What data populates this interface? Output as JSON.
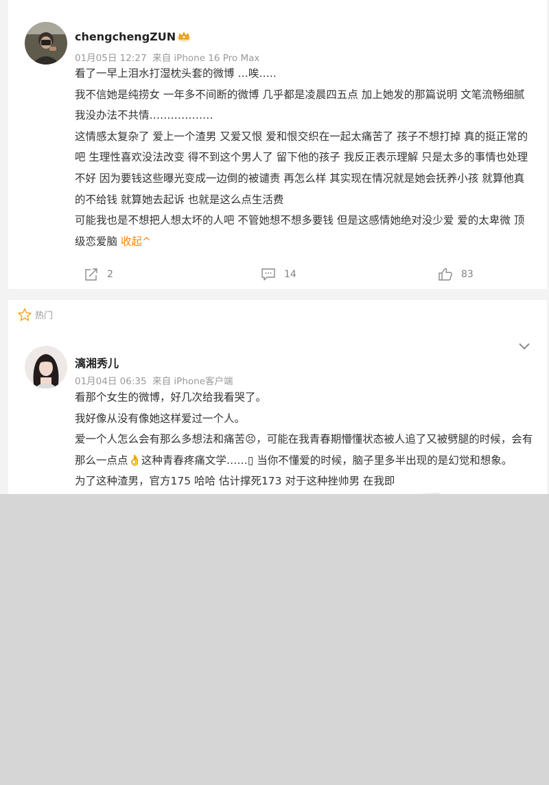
{
  "post": {
    "username": "chengchengZUN",
    "badge_icon": "crown-badge-icon",
    "meta": "01月05日 12:27  来自 iPhone 16 Pro Max",
    "paragraphs": [
      "看了一早上泪水打湿枕头套的微博 …唉…..",
      "我不信她是纯捞女 一年多不间断的微博 几乎都是凌晨四五点 加上她发的那篇说明 文笔流畅细腻 我没办法不共情………………",
      "这情感太复杂了 爱上一个渣男 又爱又恨 爱和恨交织在一起太痛苦了 孩子不想打掉 真的挺正常的吧 生理性喜欢没法改变 得不到这个男人了 留下他的孩子 我反正表示理解 只是太多的事情也处理不好 因为要钱这些曝光变成一边倒的被谴责 再怎么样 其实现在情况就是她会抚养小孩 就算他真的不给钱 就算她去起诉 也就是这么点生活费",
      "可能我也是不想把人想太坏的人吧 不管她想不想多要钱 但是这感情她绝对没少爱 爱的太卑微 顶级恋爱脑"
    ],
    "collapse_label": "收起^",
    "actions": {
      "repost_count": "2",
      "comment_count": "14",
      "like_count": "83"
    }
  },
  "hot_label": "热门",
  "comment": {
    "username": "漓湘秀儿",
    "meta": "01月04日 06:35  来自 iPhone客户端",
    "line1": "看那个女生的微博，好几次给我看哭了。",
    "line2": "我好像从没有像她这样爱过一个人。",
    "line3a": "爱一个人怎么会有那么多想法和痛苦",
    "emoji1": "😣",
    "line3b": "，可能在我青春期懵懂状态被人追了又被劈腿的时候，会有那么一点点",
    "emoji2": "👌",
    "line3c": "这种青春疼痛文学……",
    "line3d": "▯",
    "line3e": " 当你不懂爱的时候，脑子里多半出现的是幻觉和想象。",
    "line4": "为了这种渣男，官方175 哈哈 估计撑死173 对于这种挫帅男 在我即"
  },
  "colors": {
    "accent": "#ff8200",
    "meta_text": "#999999",
    "background": "#f3f3f3",
    "lower_blank": "#d6d6d6"
  }
}
